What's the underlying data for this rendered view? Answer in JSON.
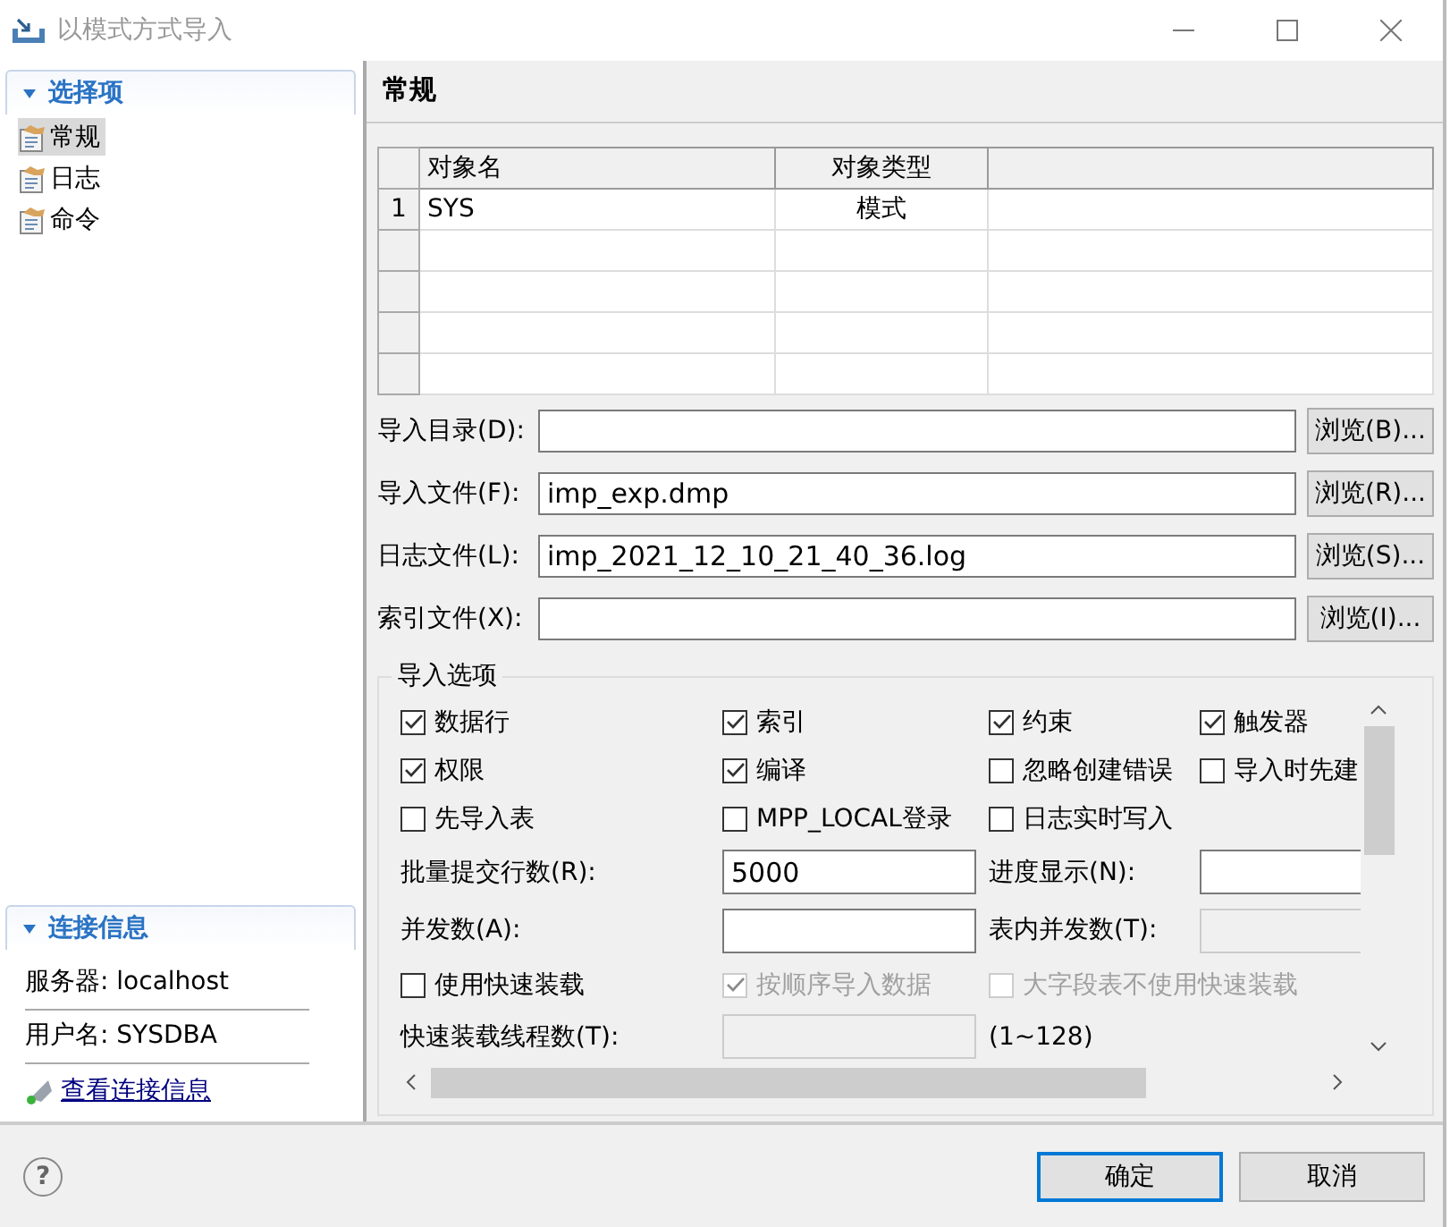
{
  "window": {
    "title": "以模式方式导入"
  },
  "sidebar": {
    "sections": [
      {
        "title": "选择项",
        "expanded": true,
        "items": [
          {
            "label": "常规",
            "selected": true
          },
          {
            "label": "日志",
            "selected": false
          },
          {
            "label": "命令",
            "selected": false
          }
        ]
      }
    ],
    "connection": {
      "title": "连接信息",
      "expanded": true,
      "lines": [
        "服务器: localhost",
        "用户名: SYSDBA"
      ],
      "link": "查看连接信息"
    }
  },
  "panel": {
    "title": "常规",
    "table": {
      "columns": [
        "对象名",
        "对象类型"
      ],
      "rows": [
        {
          "number": "1",
          "cells": [
            "SYS",
            "模式"
          ]
        }
      ]
    },
    "files": [
      {
        "label": "导入目录(D):",
        "button": "浏览(B)..."
      },
      {
        "label": "导入文件(F):",
        "value": "imp_exp.dmp",
        "button": "浏览(R)..."
      },
      {
        "label": "日志文件(L):",
        "value": "imp_2021_12_10_21_40_36.log",
        "button": "浏览(S)..."
      },
      {
        "label": "索引文件(X):",
        "button": "浏览(I)..."
      }
    ],
    "import_options": {
      "title": "导入选项",
      "rows": [
        [
          {
            "kind": "checkbox",
            "label": "数据行",
            "checked": true,
            "disabled": false
          },
          {
            "kind": "checkbox",
            "label": "索引",
            "checked": true,
            "disabled": false
          },
          {
            "kind": "checkbox",
            "label": "约束",
            "checked": true,
            "disabled": false
          },
          {
            "kind": "checkbox",
            "label": "触发器",
            "checked": true,
            "disabled": false
          }
        ],
        [
          {
            "kind": "checkbox",
            "label": "权限",
            "checked": true,
            "disabled": false
          },
          {
            "kind": "checkbox",
            "label": "编译",
            "checked": true,
            "disabled": false
          },
          {
            "kind": "checkbox",
            "label": "忽略创建错误",
            "checked": false,
            "disabled": false
          },
          {
            "kind": "checkbox",
            "label": "导入时先建",
            "checked": false,
            "disabled": false
          }
        ],
        [
          {
            "kind": "checkbox",
            "label": "先导入表",
            "checked": false,
            "disabled": false
          },
          {
            "kind": "checkbox",
            "label": "MPP_LOCAL登录",
            "checked": false,
            "disabled": false
          },
          {
            "kind": "checkbox",
            "label": "日志实时写入",
            "checked": false,
            "disabled": false
          }
        ],
        [
          {
            "kind": "label",
            "text": "批量提交行数(R):"
          },
          {
            "kind": "field",
            "value": "5000",
            "disabled": false
          },
          {
            "kind": "label",
            "text": "进度显示(N):"
          },
          {
            "kind": "field",
            "disabled": false
          }
        ],
        [
          {
            "kind": "label",
            "text": "并发数(A):"
          },
          {
            "kind": "field",
            "disabled": false
          },
          {
            "kind": "label",
            "text": "表内并发数(T):"
          },
          {
            "kind": "field",
            "disabled": true
          }
        ],
        [
          {
            "kind": "checkbox",
            "label": "使用快速装载",
            "checked": false,
            "disabled": false
          },
          {
            "kind": "checkbox",
            "label": "按顺序导入数据",
            "checked": true,
            "disabled": true
          },
          {
            "kind": "checkbox",
            "label": "大字段表不使用快速装载",
            "checked": false,
            "disabled": true
          }
        ],
        [
          {
            "kind": "label",
            "text": "快速装载线程数(T):"
          },
          {
            "kind": "field",
            "disabled": true
          },
          {
            "kind": "label",
            "text": "(1~128)"
          }
        ]
      ]
    }
  },
  "help": "?",
  "buttons": [
    {
      "label": "确定",
      "default": true
    },
    {
      "label": "取消",
      "default": false
    }
  ]
}
